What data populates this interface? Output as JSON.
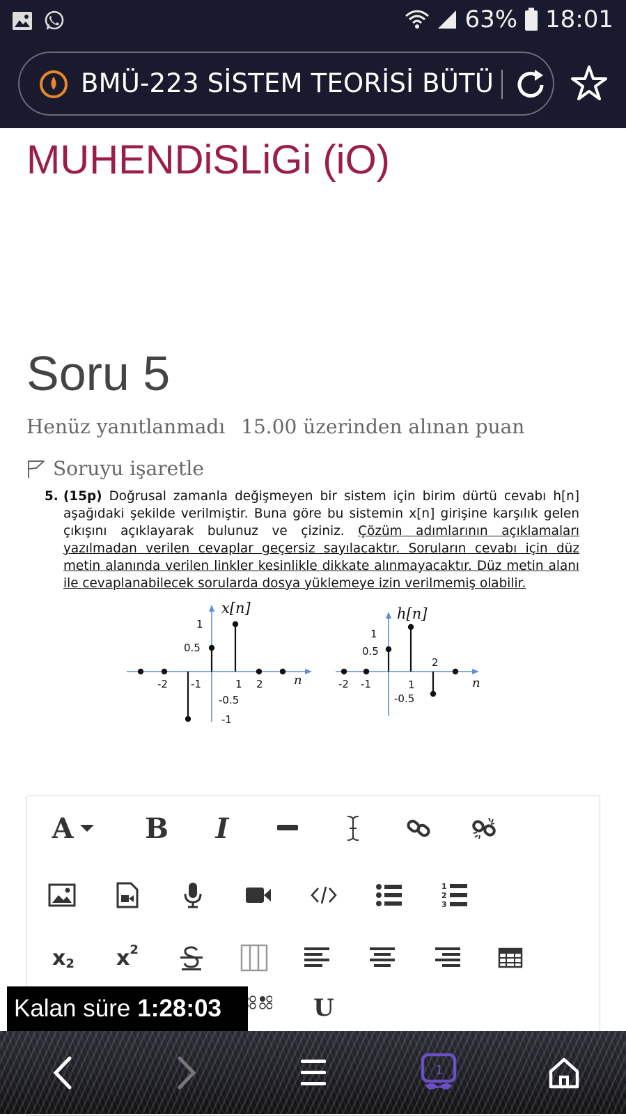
{
  "status_bar": {
    "battery": "63%",
    "time": "18:01"
  },
  "browser": {
    "url_title": "BMÜ-223 SİSTEM TEORİSİ BÜTÜ"
  },
  "page": {
    "course_heading": "MUHENDiSLiGi (iO)",
    "question_title": "Soru 5",
    "status": "Henüz yanıtlanmadı",
    "grade": "15.00 üzerinden alınan puan",
    "flag_label": "Soruyu işaretle"
  },
  "question": {
    "number": "5.",
    "points": "(15p)",
    "text_plain": " Doğrusal zamanla değişmeyen bir sistem için birim dürtü cevabı h[n] aşağıdaki şekilde verilmiştir. Buna göre bu sistemin x[n] girişine karşılık gelen çıkışını açıklayarak bulunuz ve çiziniz. ",
    "text_underlined": "Çözüm adımlarının açıklamaları yazılmadan verilen cevaplar geçersiz sayılacaktır. Soruların cevabı için düz metin alanında verilen linkler kesinlikle dikkate alınmayacaktır. Düz metin alanı ile cevaplanabilecek sorularda dosya yüklemeye izin verilmemiş olabilir."
  },
  "figure": {
    "x_title": "x[n]",
    "h_title": "h[n]",
    "n_label": "n",
    "x_labels": {
      "one": "1",
      "half": "0.5",
      "m_half": "-0.5",
      "m_one": "-1",
      "t_m2": "-2",
      "t_m1": "-1",
      "t_1": "1",
      "t_2": "2"
    },
    "h_labels": {
      "one": "1",
      "half": "0.5",
      "m_half": "-0.5",
      "two": "2",
      "t_m2": "-2",
      "t_m1": "-1",
      "t_1": "1"
    }
  },
  "chart_data": [
    {
      "type": "stem",
      "title": "x[n]",
      "xlabel": "n",
      "x": [
        -3,
        -2,
        -1,
        0,
        1,
        2,
        3
      ],
      "y": [
        0,
        0,
        -1,
        0.5,
        1,
        0,
        0
      ]
    },
    {
      "type": "stem",
      "title": "h[n]",
      "xlabel": "n",
      "x": [
        -2,
        -1,
        0,
        1,
        2,
        3
      ],
      "y": [
        0,
        0,
        0.5,
        1,
        -0.5,
        0
      ]
    }
  ],
  "editor": {
    "toolbar_row1": [
      "font-style",
      "bold",
      "italic",
      "horizontal-rule",
      "text-cursor",
      "link",
      "unlink"
    ],
    "toolbar_row2": [
      "image",
      "media-file",
      "microphone",
      "video",
      "html-source",
      "bullet-list",
      "numbered-list"
    ],
    "toolbar_row3": [
      "subscript",
      "superscript",
      "strikethrough",
      "columns",
      "align-left",
      "align-center",
      "align-right",
      "table"
    ],
    "font_label": "A",
    "bold_label": "B",
    "italic_label": "I",
    "sub_label": "x",
    "sub_suffix": "2",
    "sup_label": "x",
    "sup_suffix": "2",
    "underline_label": "U"
  },
  "timer": {
    "label": "Kalan süre",
    "value": "1:28:03"
  },
  "colors": {
    "heading": "#9b1e49",
    "accent_purple": "#6b4fc7",
    "site_icon": "#e8872a"
  }
}
